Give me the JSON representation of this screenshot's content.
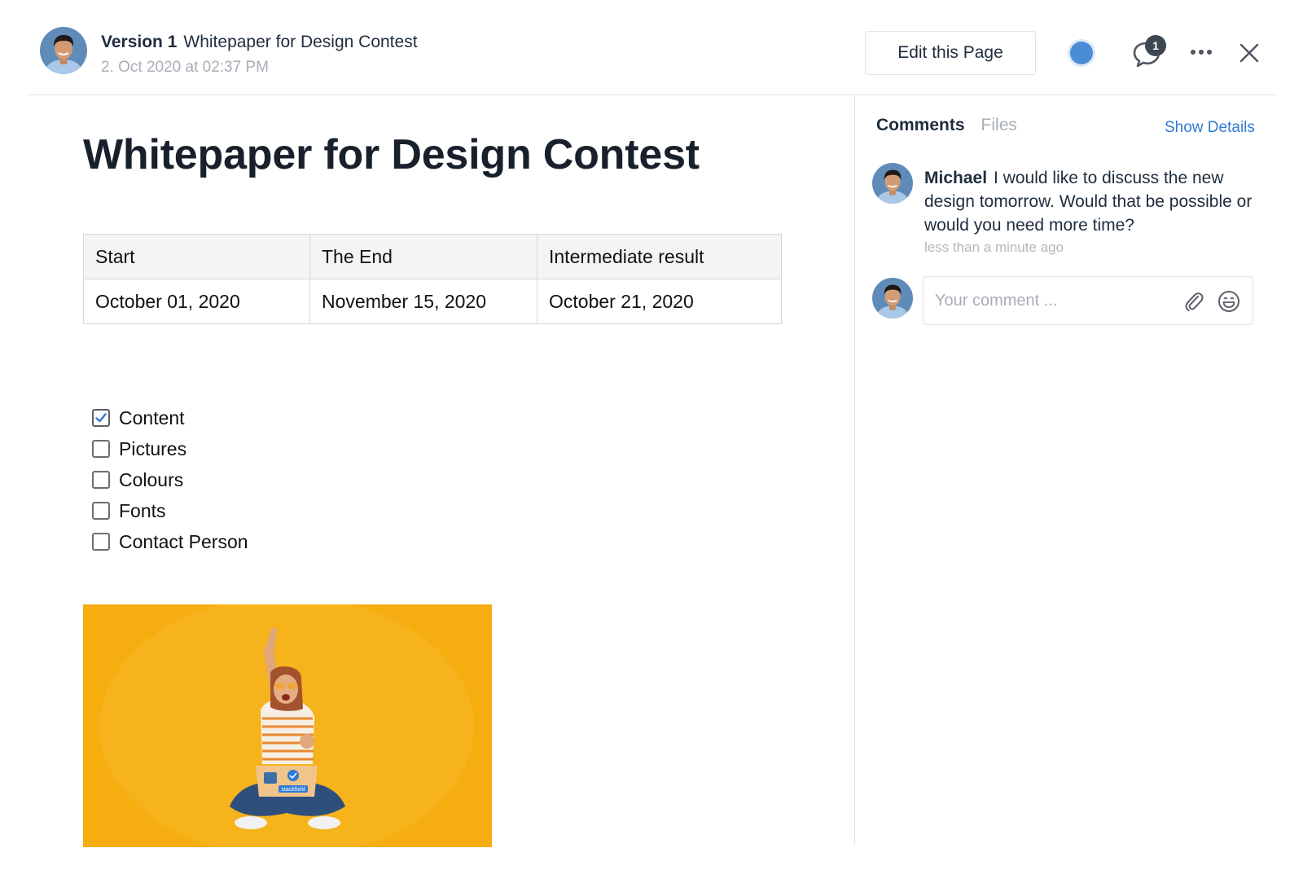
{
  "header": {
    "version": "Version 1",
    "title": "Whitepaper for Design Contest",
    "date": "2. Oct 2020 at 02:37 PM",
    "edit_label": "Edit this Page",
    "comment_count": "1",
    "icons": [
      "avatar",
      "status-dot",
      "comment-icon",
      "more-icon",
      "close-icon"
    ]
  },
  "page": {
    "title": "Whitepaper for Design Contest",
    "table": {
      "headers": [
        "Start",
        "The End",
        "Intermediate result"
      ],
      "row": [
        "October 01, 2020",
        "November 15, 2020",
        "October 21, 2020"
      ]
    },
    "checklist": [
      {
        "label": "Content",
        "checked": true
      },
      {
        "label": "Pictures",
        "checked": false
      },
      {
        "label": "Colours",
        "checked": false
      },
      {
        "label": "Fonts",
        "checked": false
      },
      {
        "label": "Contact Person",
        "checked": false
      }
    ],
    "image_sticker": "stackfield"
  },
  "sidebar": {
    "tabs": [
      "Comments",
      "Files"
    ],
    "show_details": "Show Details",
    "comment": {
      "author": "Michael",
      "text": "I would like to discuss the new design tomorrow. Would that be possible or would you need more time?",
      "time": "less than a minute ago"
    },
    "input_placeholder": "Your comment ...",
    "icons": [
      "paperclip-icon",
      "emoji-icon"
    ]
  },
  "colors": {
    "accent": "#2f7bd3",
    "status_dot": "#4a8cd6",
    "hero_background": "#f5ad0f",
    "checkbox_check": "#2f7bd3"
  }
}
